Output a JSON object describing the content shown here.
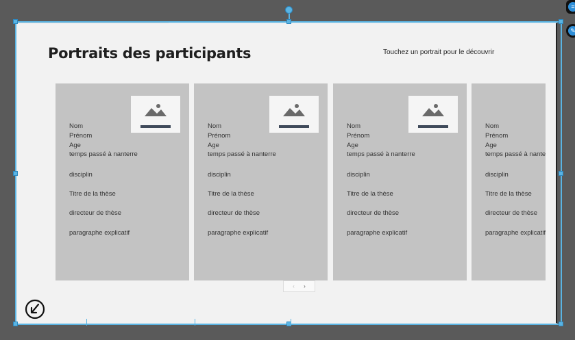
{
  "page": {
    "title": "Portraits des participants",
    "hint": "Touchez un portrait pour le découvrir"
  },
  "cards": [
    {
      "fields": [
        "Nom",
        "Prénom",
        "Age",
        "temps passé à nanterre",
        "disciplin",
        "Titre de la thèse",
        "directeur de thèse",
        "paragraphe explicatif"
      ]
    },
    {
      "fields": [
        "Nom",
        "Prénom",
        "Age",
        "temps passé à nanterre",
        "disciplin",
        "Titre de la thèse",
        "directeur de thèse",
        "paragraphe explicatif"
      ]
    },
    {
      "fields": [
        "Nom",
        "Prénom",
        "Age",
        "temps passé à nanterre",
        "disciplin",
        "Titre de la thèse",
        "directeur de thèse",
        "paragraphe explicatif"
      ]
    },
    {
      "fields": [
        "Nom",
        "Prénom",
        "Age",
        "temps passé à nanterre",
        "disciplin",
        "Titre de la thèse",
        "directeur de thèse",
        "paragraphe explicatif"
      ]
    }
  ],
  "pager": {
    "prev": "‹",
    "next": "›"
  },
  "icons": {
    "thumbnail": "image-placeholder-icon",
    "nav": "arrow-down-left-circle-icon",
    "side_top": "settings-icon",
    "side_bottom": "pin-icon"
  },
  "colors": {
    "selection": "#5ab4e3",
    "card": "#c3c3c3",
    "canvas": "#f2f2f2",
    "workspace": "#5a5a5a"
  }
}
